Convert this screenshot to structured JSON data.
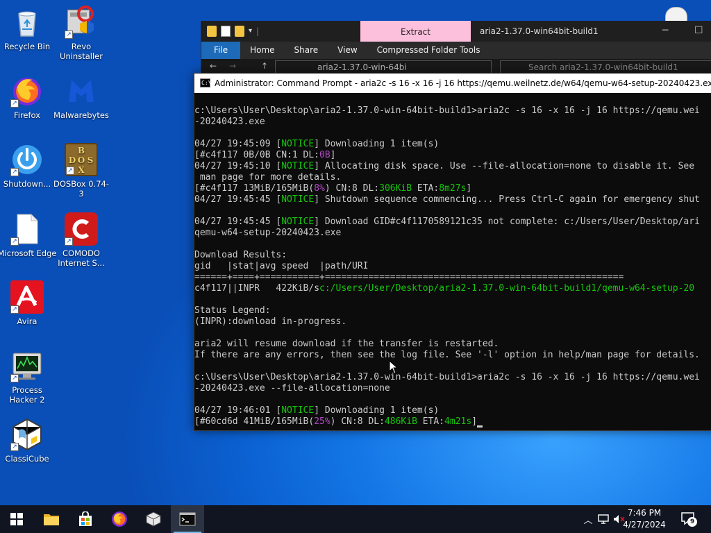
{
  "desktop": {
    "icons": [
      {
        "label": "Recycle Bin",
        "icon": "recycle-bin-icon"
      },
      {
        "label": "Revo Uninstaller",
        "icon": "revo-uninstaller-icon"
      },
      {
        "label": "Firefox",
        "icon": "firefox-icon"
      },
      {
        "label": "Malwarebytes",
        "icon": "malwarebytes-icon"
      },
      {
        "label": "Shutdown...",
        "icon": "power-icon"
      },
      {
        "label": "DOSBox 0.74-3",
        "icon": "dosbox-icon"
      },
      {
        "label": "Microsoft Edge",
        "icon": "file-icon"
      },
      {
        "label": "COMODO Internet S...",
        "icon": "comodo-icon"
      },
      {
        "label": "Avira",
        "icon": "avira-icon"
      },
      {
        "label": "Process Hacker 2",
        "icon": "process-hacker-icon"
      },
      {
        "label": "ClassiCube",
        "icon": "classicube-icon"
      }
    ],
    "dosbox_glyphs": [
      "B",
      "O",
      "D",
      "X",
      "S",
      "O"
    ]
  },
  "explorer": {
    "context_tab": "Extract",
    "title": "aria2-1.37.0-win64bit-build1",
    "tabs": [
      "File",
      "Home",
      "Share",
      "View",
      "Compressed Folder Tools"
    ],
    "address_path": "aria2-1.37.0-win-64bi",
    "search_placeholder": "Search aria2-1.37.0-win64bit-build1"
  },
  "cmd": {
    "title": "Administrator: Command Prompt - aria2c  -s 16 -x 16 -j 16 https://qemu.weilnetz.de/w64/qemu-w64-setup-20240423.exe --file-allocatio",
    "lines": [
      "c:\\Users\\User\\Desktop\\aria2-1.37.0-win-64bit-build1>aria2c -s 16 -x 16 -j 16 https://qemu.wei",
      "-20240423.exe",
      "",
      "04/27 19:45:09 [|NOTICE|] Downloading 1 item(s)",
      "[#c4f117 0B/0B CN:1 DL:|0B|]",
      "04/27 19:45:10 [|NOTICE|] Allocating disk space. Use --file-allocation=none to disable it. See",
      " man page for more details.",
      "[#c4f117 13MiB/165MiB(|8%|) CN:8 DL:|306KiB| ETA:|8m27s|]",
      "04/27 19:45:45 [|NOTICE|] Shutdown sequence commencing... Press Ctrl-C again for emergency shut",
      "",
      "04/27 19:45:45 [|NOTICE|] Download GID#c4f1170589121c35 not complete: c:/Users/User/Desktop/ari",
      "qemu-w64-setup-20240423.exe",
      "",
      "Download Results:",
      "gid   |stat|avg speed  |path/URI",
      "======+====+===========+=======================================================",
      "c4f117||INPR||   422KiB/s|c:/Users/User/Desktop/aria2-1.37.0-win-64bit-build1/qemu-w64-setup-20",
      "",
      "Status Legend:",
      "(INPR):download in-progress.",
      "",
      "aria2 will resume download if the transfer is restarted.",
      "If there are any errors, then see the log file. See '-l' option in help/man page for details.",
      "",
      "c:\\Users\\User\\Desktop\\aria2-1.37.0-win-64bit-build1>aria2c -s 16 -x 16 -j 16 https://qemu.wei",
      "-20240423.exe --file-allocation=none",
      "",
      "04/27 19:46:01 [|NOTICE|] Downloading 1 item(s)",
      "[#60cd6d 41MiB/165MiB(|25%|) CN:8 DL:|486KiB| ETA:|4m21s|]"
    ]
  },
  "taskbar": {
    "apps": [
      "start-icon",
      "file-explorer-icon",
      "store-icon",
      "firefox-icon",
      "classicube-icon",
      "command-prompt-icon"
    ],
    "time": "7:46 PM",
    "date": "4/27/2024",
    "notification_count": "9"
  },
  "colors": {
    "notice": "#16c60c",
    "value_green": "#16c60c",
    "value_purple": "#b148c6",
    "inpr": "#3a96dd",
    "extract_tab": "#fdc0dc"
  }
}
